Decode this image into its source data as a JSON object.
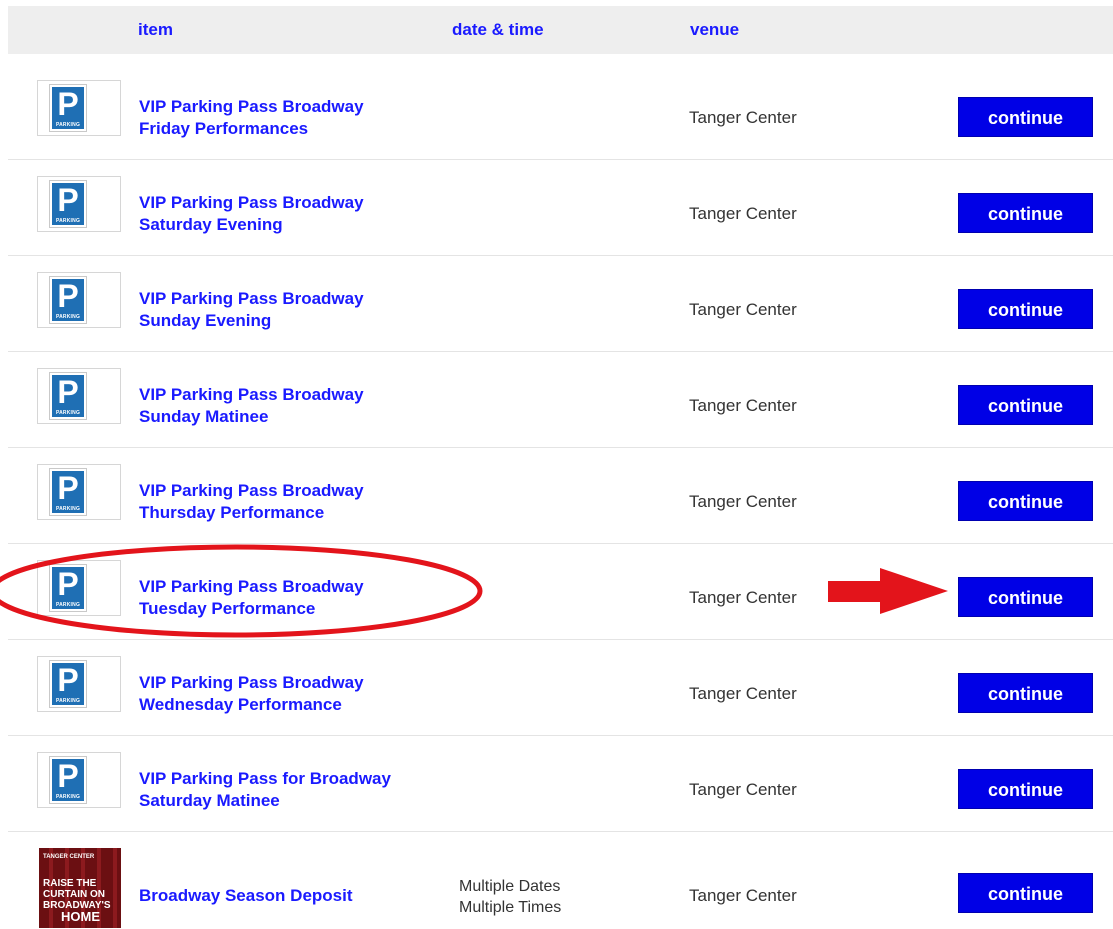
{
  "header": {
    "item": "item",
    "datetime": "date & time",
    "venue": "venue"
  },
  "rows": [
    {
      "title_line1": "VIP Parking Pass Broadway",
      "title_line2": "Friday Performances",
      "dates_line1": "",
      "dates_line2": "",
      "venue": "Tanger Center",
      "button": "continue",
      "thumb_icon": "parking-sign-icon",
      "thumb_letter": "P",
      "thumb_word": "PARKING"
    },
    {
      "title_line1": "VIP Parking Pass Broadway",
      "title_line2": "Saturday Evening",
      "dates_line1": "",
      "dates_line2": "",
      "venue": "Tanger Center",
      "button": "continue",
      "thumb_icon": "parking-sign-icon",
      "thumb_letter": "P",
      "thumb_word": "PARKING"
    },
    {
      "title_line1": "VIP Parking Pass Broadway",
      "title_line2": "Sunday Evening",
      "dates_line1": "",
      "dates_line2": "",
      "venue": "Tanger Center",
      "button": "continue",
      "thumb_icon": "parking-sign-icon",
      "thumb_letter": "P",
      "thumb_word": "PARKING"
    },
    {
      "title_line1": "VIP Parking Pass Broadway",
      "title_line2": "Sunday Matinee",
      "dates_line1": "",
      "dates_line2": "",
      "venue": "Tanger Center",
      "button": "continue",
      "thumb_icon": "parking-sign-icon",
      "thumb_letter": "P",
      "thumb_word": "PARKING"
    },
    {
      "title_line1": "VIP Parking Pass Broadway",
      "title_line2": "Thursday Performance",
      "dates_line1": "",
      "dates_line2": "",
      "venue": "Tanger Center",
      "button": "continue",
      "thumb_icon": "parking-sign-icon",
      "thumb_letter": "P",
      "thumb_word": "PARKING"
    },
    {
      "title_line1": "VIP Parking Pass Broadway",
      "title_line2": "Tuesday Performance",
      "dates_line1": "",
      "dates_line2": "",
      "venue": "Tanger Center",
      "button": "continue",
      "thumb_icon": "parking-sign-icon",
      "thumb_letter": "P",
      "thumb_word": "PARKING"
    },
    {
      "title_line1": "VIP Parking Pass Broadway",
      "title_line2": "Wednesday Performance",
      "dates_line1": "",
      "dates_line2": "",
      "venue": "Tanger Center",
      "button": "continue",
      "thumb_icon": "parking-sign-icon",
      "thumb_letter": "P",
      "thumb_word": "PARKING"
    },
    {
      "title_line1": "VIP Parking Pass for Broadway",
      "title_line2": "Saturday Matinee",
      "dates_line1": "",
      "dates_line2": "",
      "venue": "Tanger Center",
      "button": "continue",
      "thumb_icon": "parking-sign-icon",
      "thumb_letter": "P",
      "thumb_word": "PARKING"
    },
    {
      "title_line1": "Broadway Season Deposit",
      "title_line2": "",
      "dates_line1": "Multiple Dates",
      "dates_line2": "Multiple Times",
      "venue": "Tanger Center",
      "button": "continue",
      "thumb_icon": "broadway-season-poster",
      "poster_line1": "TANGER CENTER",
      "poster_line2": "RAISE THE CURTAIN ON BROADWAY'S",
      "poster_line3": "HOME"
    }
  ],
  "annotations": {
    "highlight_color": "#e3141b",
    "circled_row": "Tuesday Performance",
    "arrow_target": "continue"
  },
  "colors": {
    "link": "#1a1aff",
    "button_bg": "#0000e6",
    "header_bg": "#eeeeee",
    "parking_blue": "#1f6fb4"
  }
}
